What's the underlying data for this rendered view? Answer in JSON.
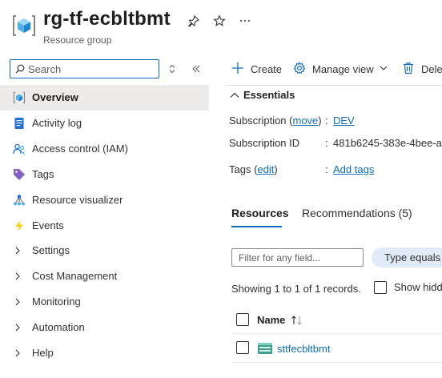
{
  "header": {
    "title": "rg-tf-ecbltbmt",
    "subtitle": "Resource group",
    "icons": [
      "resource-group-icon",
      "pin-icon",
      "star-icon",
      "more-icon"
    ]
  },
  "sidebar": {
    "search_placeholder": "Search",
    "items": [
      {
        "label": "Overview",
        "icon": "overview-icon",
        "selected": true
      },
      {
        "label": "Activity log",
        "icon": "activity-log-icon"
      },
      {
        "label": "Access control (IAM)",
        "icon": "iam-icon"
      },
      {
        "label": "Tags",
        "icon": "tag-icon"
      },
      {
        "label": "Resource visualizer",
        "icon": "visualizer-icon"
      },
      {
        "label": "Events",
        "icon": "events-icon"
      },
      {
        "label": "Settings",
        "icon": "chevron-right-icon"
      },
      {
        "label": "Cost Management",
        "icon": "chevron-right-icon"
      },
      {
        "label": "Monitoring",
        "icon": "chevron-right-icon"
      },
      {
        "label": "Automation",
        "icon": "chevron-right-icon"
      },
      {
        "label": "Help",
        "icon": "chevron-right-icon"
      }
    ]
  },
  "toolbar": {
    "create_label": "Create",
    "manage_view_label": "Manage view",
    "delete_label": "Dele"
  },
  "essentials": {
    "heading": "Essentials",
    "subscription_label": "Subscription",
    "subscription_move": "move",
    "subscription_value": "DEV",
    "subscription_id_label": "Subscription ID",
    "subscription_id_value": "481b6245-383e-4bee-a",
    "tags_label": "Tags",
    "tags_edit": "edit",
    "tags_value": "Add tags",
    "colon": ":"
  },
  "tabs": [
    {
      "label": "Resources",
      "active": true
    },
    {
      "label": "Recommendations (5)",
      "active": false
    }
  ],
  "filter": {
    "placeholder": "Filter for any field...",
    "pill_label": "Type equals"
  },
  "records": {
    "showing_text": "Showing 1 to 1 of 1 records.",
    "show_hidden_label": "Show hidd"
  },
  "table": {
    "name_header": "Name",
    "rows": [
      {
        "name": "sttfecbltbmt",
        "icon": "storage-account-icon"
      }
    ]
  },
  "colors": {
    "accent": "#0f6cbd",
    "selected_bg": "#edebe9",
    "pill_bg": "#e0ebf7"
  }
}
